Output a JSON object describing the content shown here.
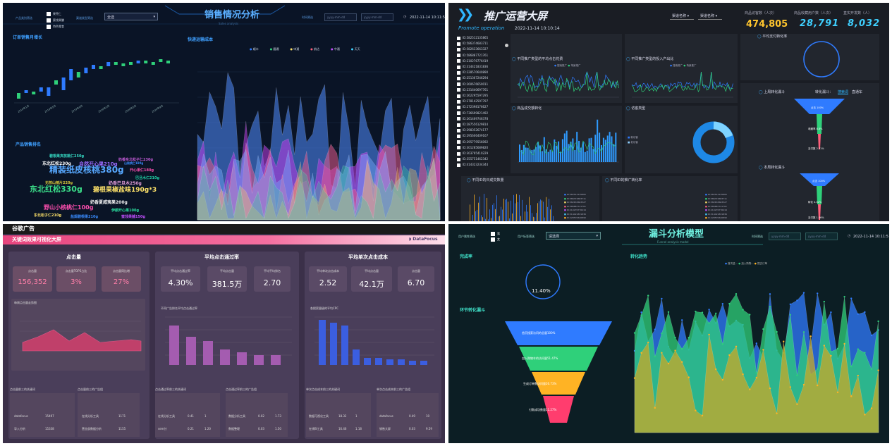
{
  "p1": {
    "title": "销售情况分析",
    "subtitle": "Sales analysis",
    "filter1": "产品类别筛选",
    "chk": [
      "果壳仁",
      "蜜饯果脯",
      "特色零食"
    ],
    "filter2": "渠道类型筛选",
    "select": "全选",
    "dateLabel": "时间筛选",
    "date1": "yyyy-mm-dd",
    "date2": "yyyy-mm-dd",
    "clock": "2022-11-14 10:11:5",
    "sec1": "订单销售月增长",
    "sec2": "快递运输成本",
    "sec3": "产品销售排名",
    "legend": [
      "顺丰",
      "圆通",
      "申通",
      "韵达",
      "中通",
      "天天"
    ],
    "months": [
      "2019年1月",
      "2019年3月",
      "2019年5月",
      "2019年7月",
      "2019年9月",
      "2019年11月",
      "2020年1月",
      "2020年3月",
      "2020年5月",
      "2020年7月",
      "2020年9月",
      "2020年11月"
    ],
    "words": [
      {
        "t": "碧根果夹核桃仁250g",
        "c": "#36e0c8"
      },
      {
        "t": "奶香东北松子仁230g",
        "c": "#c45cd8"
      },
      {
        "t": "东北红松230g",
        "c": "#fff"
      },
      {
        "t": "自然开心果210g",
        "c": "#9b6bff"
      },
      {
        "t": "精装纸皮核桃380g",
        "c": "#57a8ff"
      },
      {
        "t": "开心果仁180g",
        "c": "#ff4fb0"
      },
      {
        "t": "巴旦木仁210g",
        "c": "#1fd3a6"
      },
      {
        "t": "无核山楂片220g",
        "c": "#d8c83a"
      },
      {
        "t": "奶香巴旦木250g",
        "c": "#e09bd8"
      },
      {
        "t": "东北红松330g",
        "c": "#3be08a"
      },
      {
        "t": "碧根果椒盐味190g*3",
        "c": "#ffe36a"
      },
      {
        "t": "奶香夏威夷果200g",
        "c": "#f5f5f5"
      },
      {
        "t": "野山小核桃仁100g",
        "c": "#ff4fb0"
      },
      {
        "t": "伊朗开心果100g",
        "c": "#2be0a0"
      },
      {
        "t": "盐焗碧根果210g",
        "c": "#3a8cff"
      },
      {
        "t": "蜜饯果脯150g",
        "c": "#c24fff"
      },
      {
        "t": "东北松子仁210g",
        "c": "#ffe36a"
      },
      {
        "t": "山核桃仁180g",
        "c": "#3a8cff"
      }
    ]
  },
  "p2": {
    "title": "推广运营大屏",
    "subtitle": "Promote operation",
    "datetime": "2022-11-14 10:10:14",
    "sel1": "渠道名称",
    "sel2": "渠道名称",
    "k1l": "商品访客数（人次）",
    "k1": "474,805",
    "k2l": "商品收藏用户数（人次）",
    "k2": "28,791",
    "k3l": "直实开发数（人）",
    "k3": "8,032",
    "c1": "不同推广类型的平均点击花费",
    "c2": "不同推广类型的投入产出比",
    "c3": "平均支付转化率",
    "c4": "商品成交额转化",
    "c5": "访客类型",
    "c6": "上周转化漏斗",
    "c7": "转化漏斗：",
    "c8": "搜索词",
    "c9": "直通车",
    "c10": "本周转化漏斗",
    "c11": "不同ID的日成交数量",
    "c12": "不同ID的推广转化率",
    "lg1": "搜索推广",
    "lg2": "场景推广",
    "lg3": "新访客",
    "lg4": "老访客",
    "ids": [
      "ID:582512135865",
      "ID:586374683711",
      "ID:582633663327",
      "ID:586887721761",
      "ID:210276776419",
      "ID:314421831836",
      "ID:228570640890",
      "ID:251367246294",
      "ID:260676650011",
      "ID:231640697761",
      "ID:262295597295",
      "ID:278142597797",
      "ID:272398176627",
      "ID:736699821492",
      "ID:261469746378",
      "ID:287556129814",
      "ID:298352674177",
      "ID:295606409167",
      "ID:295779556092",
      "ID:301285689820",
      "ID:303765410229",
      "ID:355751462342",
      "ID:414323234344"
    ],
    "f1": [
      "点击 100%",
      "收藏率 8.8%",
      "支付数 2.21%"
    ],
    "f2": [
      "点击 100%",
      "转化 4.02%",
      "支付数 1.06%"
    ]
  },
  "p3": {
    "top": "谷歌广告",
    "band": "关键词效果可视化大屏",
    "logo": "DataFocus",
    "h1": "点击量",
    "h2": "平均点击通过率",
    "h3": "平均单次点击成本",
    "k": [
      {
        "l": "点击量",
        "v": "156,352"
      },
      {
        "l": "点击量TOP5占比",
        "v": "3%"
      },
      {
        "l": "点击量同比增",
        "v": "27%"
      },
      {
        "l": "平均点击通过率",
        "v": "4.30%"
      },
      {
        "l": "平均点击量",
        "v": "381.5万"
      },
      {
        "l": "平均平均排名",
        "v": "2.70"
      },
      {
        "l": "平均单次点击成本",
        "v": "2.52"
      },
      {
        "l": "平均点击量",
        "v": "42.1万"
      },
      {
        "l": "点击量",
        "v": "6.70"
      }
    ],
    "g1": "每周点击量走势图",
    "g2": "不同广告排名平均点击通过率",
    "g3": "各搜索量级的平均CPC",
    "t1": "点击量前三的关键词",
    "t2": "点击量前三的广告组",
    "t3": "点击通过率前三的关键词",
    "t4": "点击通过率前三的广告组",
    "t5": "单次点击成本前三的关键词",
    "t6": "单次点击成本前三的广告组",
    "rows": [
      [
        "datafocus",
        "15497",
        "在线分析工具",
        "1171"
      ],
      [
        "导入分析",
        "15338",
        "营业部数据分析",
        "1155"
      ],
      [
        "在线分析工具",
        "0.41",
        "1",
        "数据分析工具",
        "0.02",
        "1.73"
      ],
      [
        "sem分",
        "0.21",
        "1.20",
        "数据整理",
        "0.03",
        "1.50"
      ],
      [
        "数据可视化工具",
        "18.32",
        "1",
        "datafocus",
        "0.49",
        "10"
      ],
      [
        "在线BI工具",
        "16.46",
        "1.18",
        "销售大屏",
        "0.03",
        "9.59"
      ]
    ]
  },
  "p4": {
    "f1": "用户属性筛选",
    "chk": [
      "男",
      "女"
    ],
    "f2": "用户标签筛选",
    "select": "请选择",
    "title": "漏斗分析模型",
    "subtitle": "Funnel analysis model",
    "dateLabel": "时间筛选",
    "date1": "yyyy-mm-dd",
    "date2": "yyyy-mm-dd",
    "clock": "2022-11-14 10:11:5",
    "s1": "完成率",
    "ring": "11.40%",
    "s2": "环节转化漏斗",
    "s3": "转化趋势",
    "lg": [
      "首次进...",
      "加入购物...",
      "提交订单"
    ],
    "fn": [
      "首页搜索访问的总量100%",
      "加入购物车的访问量51.47%",
      "生成订单数访问量26.73%",
      "付款成功数量11.27%"
    ]
  }
}
